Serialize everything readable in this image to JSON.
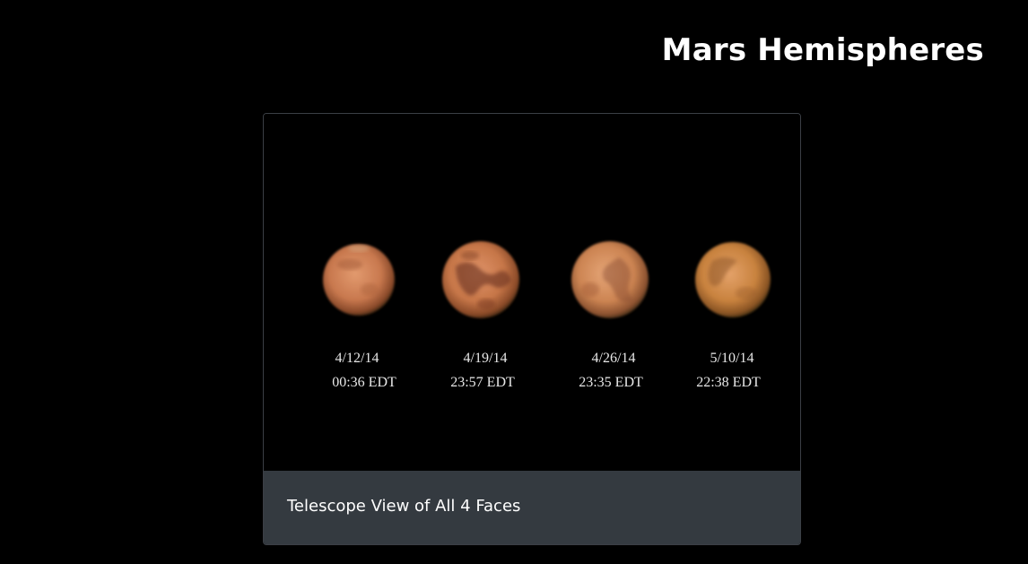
{
  "page": {
    "title": "Mars Hemispheres"
  },
  "card": {
    "caption": "Telescope View of All 4 Faces",
    "photo": {
      "subject": "mars-telescope-composite",
      "observations": [
        {
          "date": "4/12/14",
          "time": "00:36 EDT"
        },
        {
          "date": "4/19/14",
          "time": "23:57 EDT"
        },
        {
          "date": "4/26/14",
          "time": "23:35 EDT"
        },
        {
          "date": "5/10/14",
          "time": "22:38 EDT"
        }
      ]
    }
  },
  "colors": {
    "background": "#000000",
    "caption_bar": "#343a40",
    "card_border": "#3b3f45",
    "title_text": "#ffffff",
    "mars_base": "#c8784a",
    "mars_dark": "#7a3c22"
  }
}
